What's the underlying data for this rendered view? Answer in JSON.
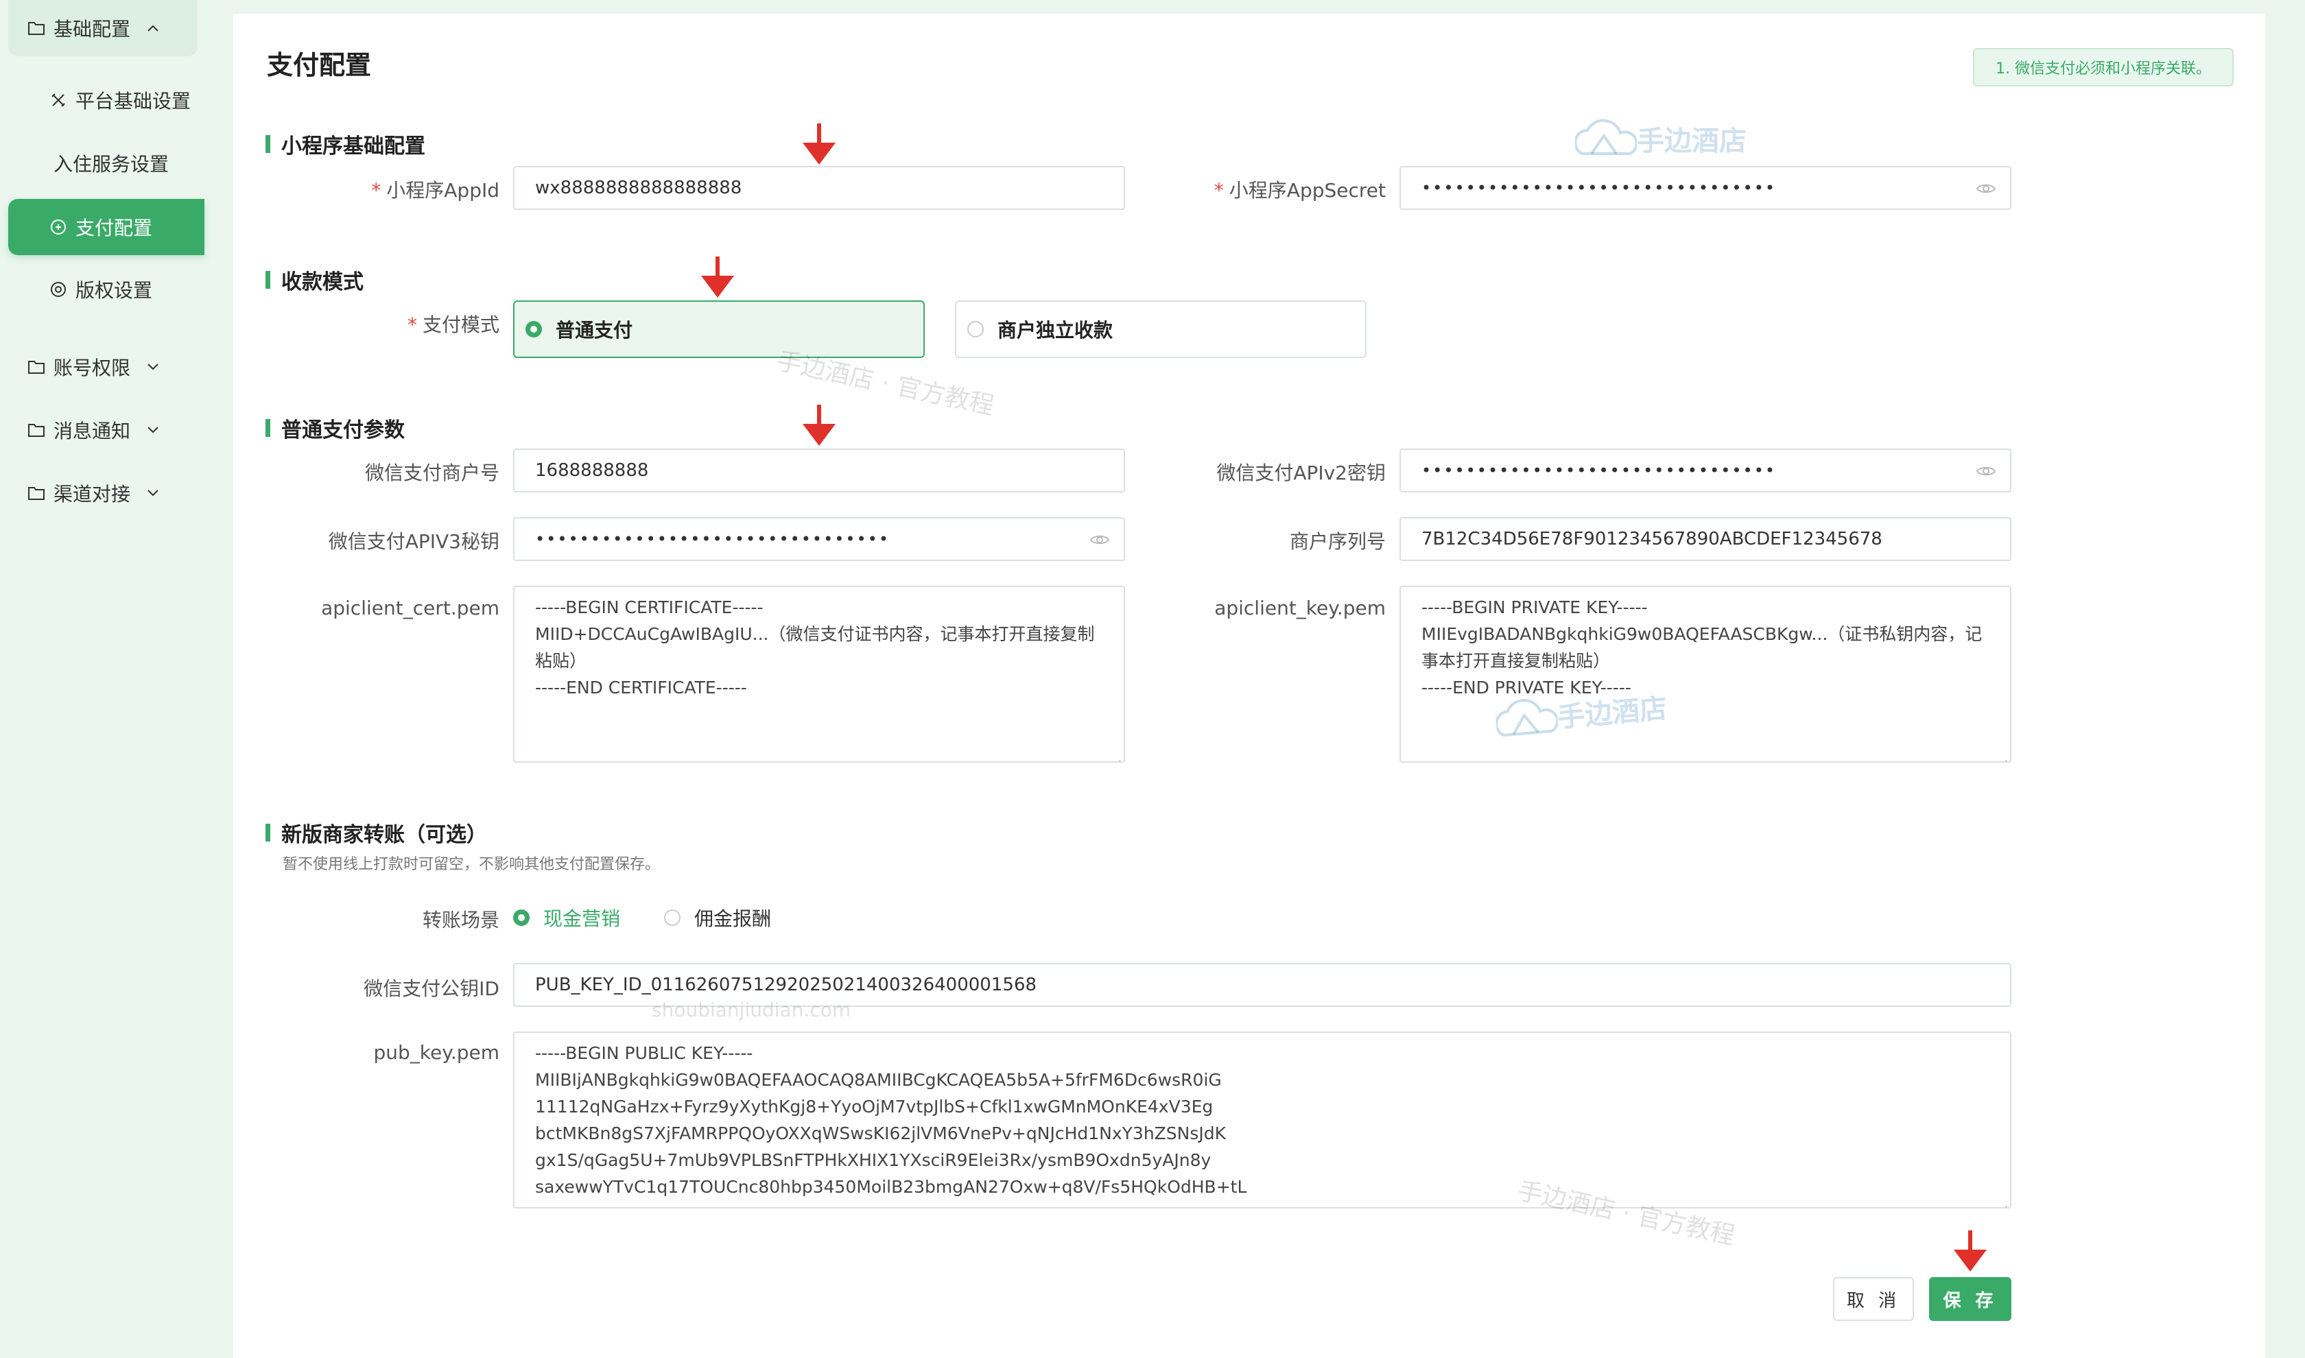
{
  "sidebar": {
    "group_basic": "基础配置",
    "items": [
      {
        "label": "平台基础设置"
      },
      {
        "label": "入住服务设置"
      },
      {
        "label": "支付配置"
      },
      {
        "label": "版权设置"
      }
    ],
    "group_account": "账号权限",
    "group_message": "消息通知",
    "group_channel": "渠道对接"
  },
  "page": {
    "title": "支付配置",
    "notice": "1. 微信支付必须和小程序关联。"
  },
  "sections": {
    "mini": "小程序基础配置",
    "mode": "收款模式",
    "params": "普通支付参数",
    "transfer": "新版商家转账（可选）",
    "transfer_hint": "暂不使用线上打款时可留空，不影响其他支付配置保存。"
  },
  "fields": {
    "appid_label": "小程序AppId",
    "appid_value": "wx8888888888888888",
    "secret_label": "小程序AppSecret",
    "secret_value": "••••••••••••••••••••••••••••••••",
    "mode_label": "支付模式",
    "mode_opt1": "普通支付",
    "mode_opt2": "商户独立收款",
    "mchid_label": "微信支付商户号",
    "mchid_value": "1688888888",
    "apiv2_label": "微信支付APIv2密钥",
    "apiv2_value": "••••••••••••••••••••••••••••••••",
    "apiv3_label": "微信支付APIV3秘钥",
    "apiv3_value": "••••••••••••••••••••••••••••••••",
    "serial_label": "商户序列号",
    "serial_value": "7B12C34D56E78F901234567890ABCDEF12345678",
    "cert_label": "apiclient_cert.pem",
    "cert_value": "-----BEGIN CERTIFICATE-----\nMIID+DCCAuCgAwIBAgIU...（微信支付证书内容，记事本打开直接复制粘贴）\n-----END CERTIFICATE-----",
    "key_label": "apiclient_key.pem",
    "key_value": "-----BEGIN PRIVATE KEY-----\nMIIEvgIBADANBgkqhkiG9w0BAQEFAASCBKgw...（证书私钥内容，记事本打开直接复制粘贴）\n-----END PRIVATE KEY-----",
    "scene_label": "转账场景",
    "scene_opt1": "现金营销",
    "scene_opt2": "佣金报酬",
    "pubkeyid_label": "微信支付公钥ID",
    "pubkeyid_value": "PUB_KEY_ID_0116260751292025021400326400001568",
    "pubkey_label": "pub_key.pem",
    "pubkey_value": "-----BEGIN PUBLIC KEY-----\nMIIBIjANBgkqhkiG9w0BAQEFAAOCAQ8AMIIBCgKCAQEA5b5A+5frFM6Dc6wsR0iG\n11112qNGaHzx+Fyrz9yXythKgj8+YyoOjM7vtpJlbS+Cfkl1xwGMnMOnKE4xV3Eg\nbctMKBn8gS7XjFAMRPPQOyOXXqWSwsKI62jlVM6VnePv+qNJcHd1NxY3hZSNsJdK\ngx1S/qGag5U+7mUb9VPLBSnFTPHkXHIX1YXsciR9Elei3Rx/ysmB9Oxdn5yAJn8y\nsaxewwYTvC1q17TOUCnc80hbp3450MoilB23bmgAN27Oxw+q8V/Fs5HQkOdHB+tL"
  },
  "buttons": {
    "cancel": "取 消",
    "save": "保 存"
  },
  "watermarks": {
    "logo_text": "手边酒店",
    "tutorial": "手边酒店 · 官方教程",
    "domain": "shoubianjiudian.com"
  },
  "colors": {
    "accent": "#3aaa68",
    "required": "#e04a3f",
    "arrow": "#e0302a"
  }
}
